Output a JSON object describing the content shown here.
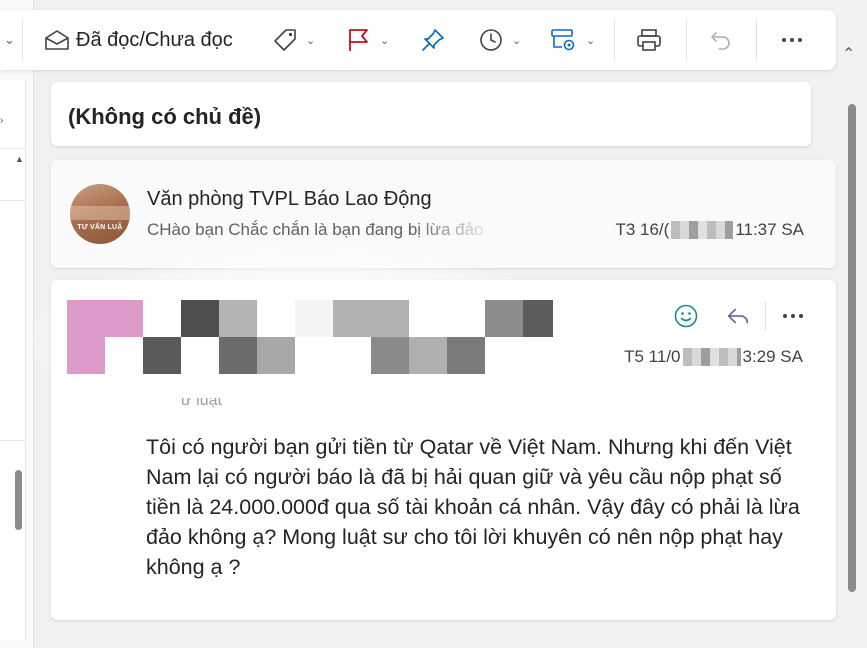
{
  "toolbar": {
    "read_unread_label": "Đã đọc/Chưa đọc",
    "icons": [
      "envelope-open-icon",
      "tag-icon",
      "flag-icon",
      "pin-icon",
      "clock-icon",
      "rules-icon",
      "print-icon",
      "undo-icon",
      "more-icon"
    ]
  },
  "subject": {
    "title": "(Không có chủ đề)"
  },
  "collapsed_message": {
    "sender": "Văn phòng TVPL Báo Lao Động",
    "avatar_text": "TƯ VẤN LUẬ",
    "preview": "CHào bạn Chắc chắn là bạn đang bị lừa đảo",
    "time_prefix": "T3 16/(",
    "time_suffix": "11:37 SA"
  },
  "expanded_message": {
    "time_prefix": "T5 11/0",
    "time_suffix": "3:29 SA",
    "quote_fragment": "ư luật",
    "body": "Tôi có người bạn gửi tiền từ Qatar về Việt Nam. Nhưng khi đến Việt Nam lại có người báo là đã bị hải quan giữ và yêu cầu nộp phạt số tiền là 24.000.000đ qua số tài khoản cá nhân. Vậy đây có phải là lừa đảo không ạ? Mong luật sư cho tôi lời khuyên có nên nộp phạt hay không ạ ?"
  },
  "colors": {
    "accent": "#c50f1f",
    "brand_blue": "#0f6cbd",
    "emoji_teal": "#1b8a8f",
    "reply_purple": "#6b4fa3"
  }
}
